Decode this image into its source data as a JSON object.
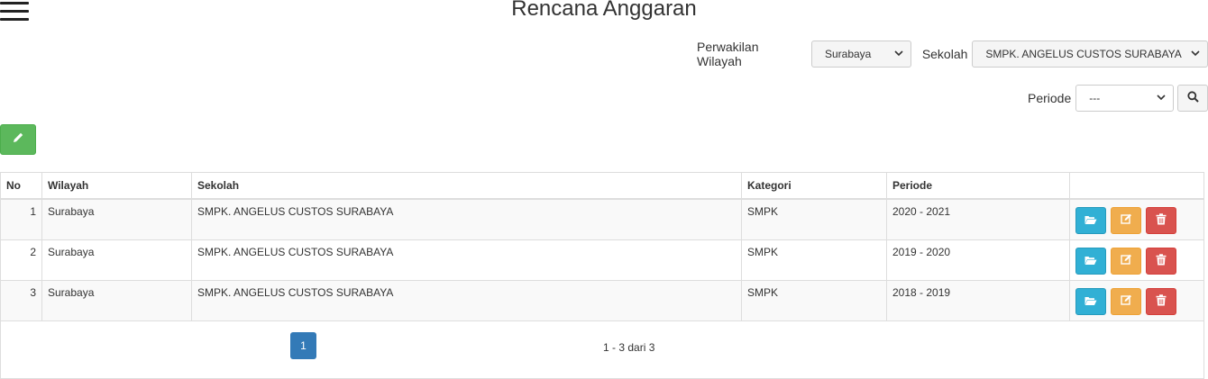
{
  "title": "Rencana Anggaran",
  "filters": {
    "wilayah_label": "Perwakilan Wilayah",
    "wilayah_value": "Surabaya",
    "sekolah_label": "Sekolah",
    "sekolah_value": "SMPK. ANGELUS CUSTOS SURABAYA",
    "periode_label": "Periode",
    "periode_value": "---"
  },
  "table": {
    "headers": [
      "No",
      "Wilayah",
      "Sekolah",
      "Kategori",
      "Periode"
    ],
    "rows": [
      {
        "no": "1",
        "wilayah": "Surabaya",
        "sekolah": "SMPK. ANGELUS CUSTOS SURABAYA",
        "kategori": "SMPK",
        "periode": "2020 - 2021"
      },
      {
        "no": "2",
        "wilayah": "Surabaya",
        "sekolah": "SMPK. ANGELUS CUSTOS SURABAYA",
        "kategori": "SMPK",
        "periode": "2019 - 2020"
      },
      {
        "no": "3",
        "wilayah": "Surabaya",
        "sekolah": "SMPK. ANGELUS CUSTOS SURABAYA",
        "kategori": "SMPK",
        "periode": "2018 - 2019"
      }
    ]
  },
  "pagination": {
    "current_page": "1",
    "summary": "1 - 3 dari 3"
  },
  "colors": {
    "add": "#5cb85c",
    "open": "#31b0d5",
    "edit": "#f0ad4e",
    "delete": "#d9534f",
    "page_active": "#337ab7"
  },
  "icons": {
    "menu": "hamburger-icon",
    "add": "pencil-icon",
    "search": "search-icon",
    "open": "folder-open-icon",
    "edit": "edit-icon",
    "delete": "trash-icon"
  }
}
